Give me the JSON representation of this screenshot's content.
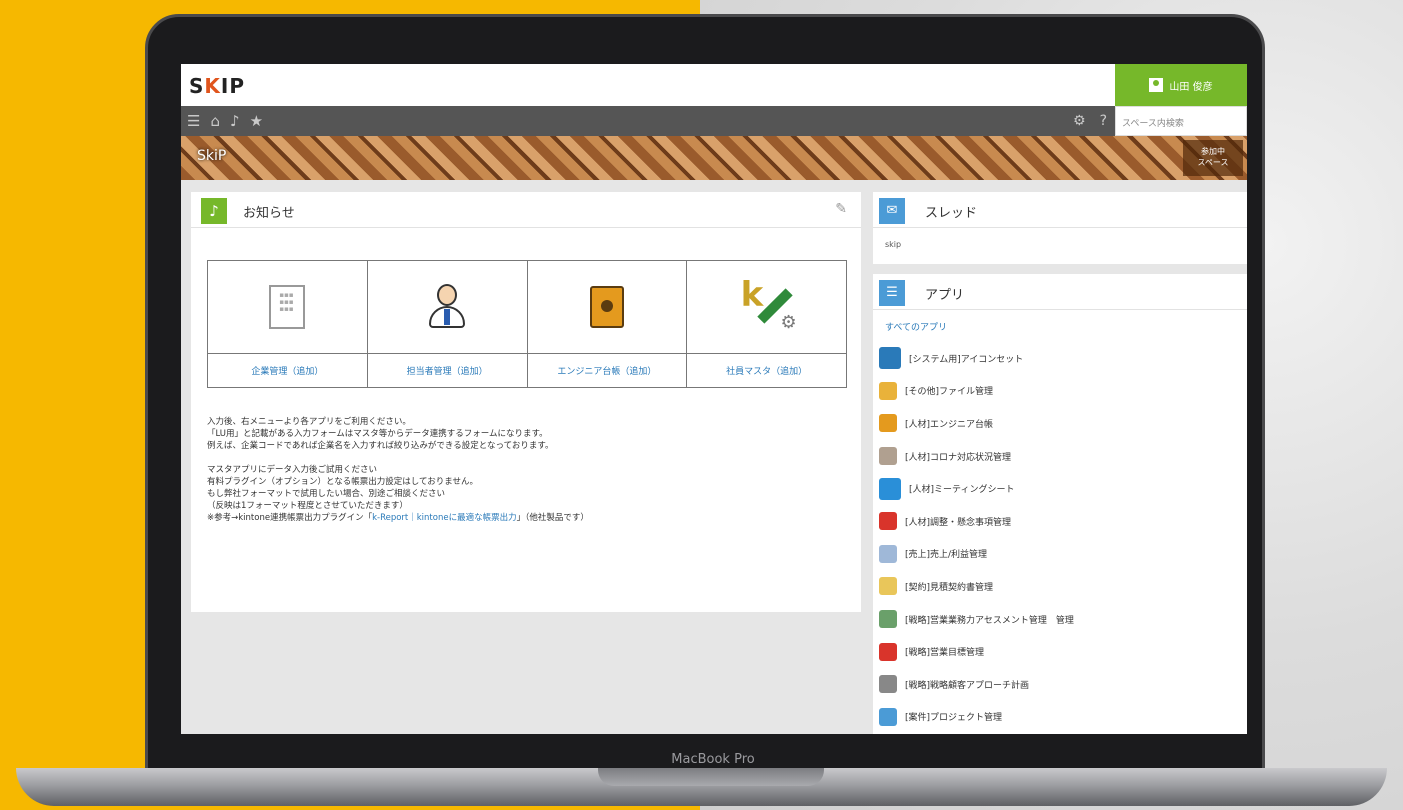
{
  "device_label": "MacBook Pro",
  "app": {
    "logo_s": "S",
    "logo_k": "K",
    "logo_ip": "IP",
    "user_name": "山田 俊彦",
    "search_placeholder": "スペース内検索",
    "banner_title": "SkiP",
    "banner_right_line1": "参加中",
    "banner_right_line2": "スペース"
  },
  "notice": {
    "title": "お知らせ",
    "apps": [
      {
        "label": "企業管理（追加）"
      },
      {
        "label": "担当者管理（追加）"
      },
      {
        "label": "エンジニア台帳（追加）"
      },
      {
        "label": "社員マスタ（追加）"
      }
    ],
    "paragraphs": [
      [
        "入力後、右メニューより各アプリをご利用ください。",
        "「LU用」と記載がある入力フォームはマスタ等からデータ連携するフォームになります。",
        "例えば、企業コードであれば企業名を入力すれば絞り込みができる設定となっております。"
      ],
      [
        "マスタアプリにデータ入力後ご試用ください",
        "有料プラグイン（オプション）となる帳票出力設定はしておりません。",
        "もし弊社フォーマットで試用したい場合、別途ご相談ください",
        "（反映は1フォーマット程度とさせていただきます）"
      ]
    ],
    "ref_prefix": "※参考→kintone連携帳票出力プラグイン「",
    "ref_link": "k-Report｜kintoneに最適な帳票出力",
    "ref_suffix": "」（他社製品です）"
  },
  "thread": {
    "title": "スレッド",
    "sub": "skip"
  },
  "apps": {
    "title": "アプリ",
    "all_label": "すべてのアプリ",
    "items": [
      {
        "label": "[システム用]アイコンセット",
        "color": "#2a7ab9"
      },
      {
        "label": "[その他]ファイル管理",
        "color": "#e9b23a"
      },
      {
        "label": "[人材]エンジニア台帳",
        "color": "#e49a1e"
      },
      {
        "label": "[人材]コロナ対応状況管理",
        "color": "#b0a090"
      },
      {
        "label": "[人材]ミーティングシート",
        "color": "#2a8fd8"
      },
      {
        "label": "[人材]調整・懸念事項管理",
        "color": "#d9342b"
      },
      {
        "label": "[売上]売上/利益管理",
        "color": "#9fb8d8"
      },
      {
        "label": "[契約]見積契約書管理",
        "color": "#e9c65a"
      },
      {
        "label": "[戦略]営業業務力アセスメント管理　管理",
        "color": "#6aa06a"
      },
      {
        "label": "[戦略]営業目標管理",
        "color": "#d9342b"
      },
      {
        "label": "[戦略]戦略顧客アプローチ計画",
        "color": "#888888"
      },
      {
        "label": "[案件]プロジェクト管理",
        "color": "#4b9bd6"
      }
    ]
  }
}
